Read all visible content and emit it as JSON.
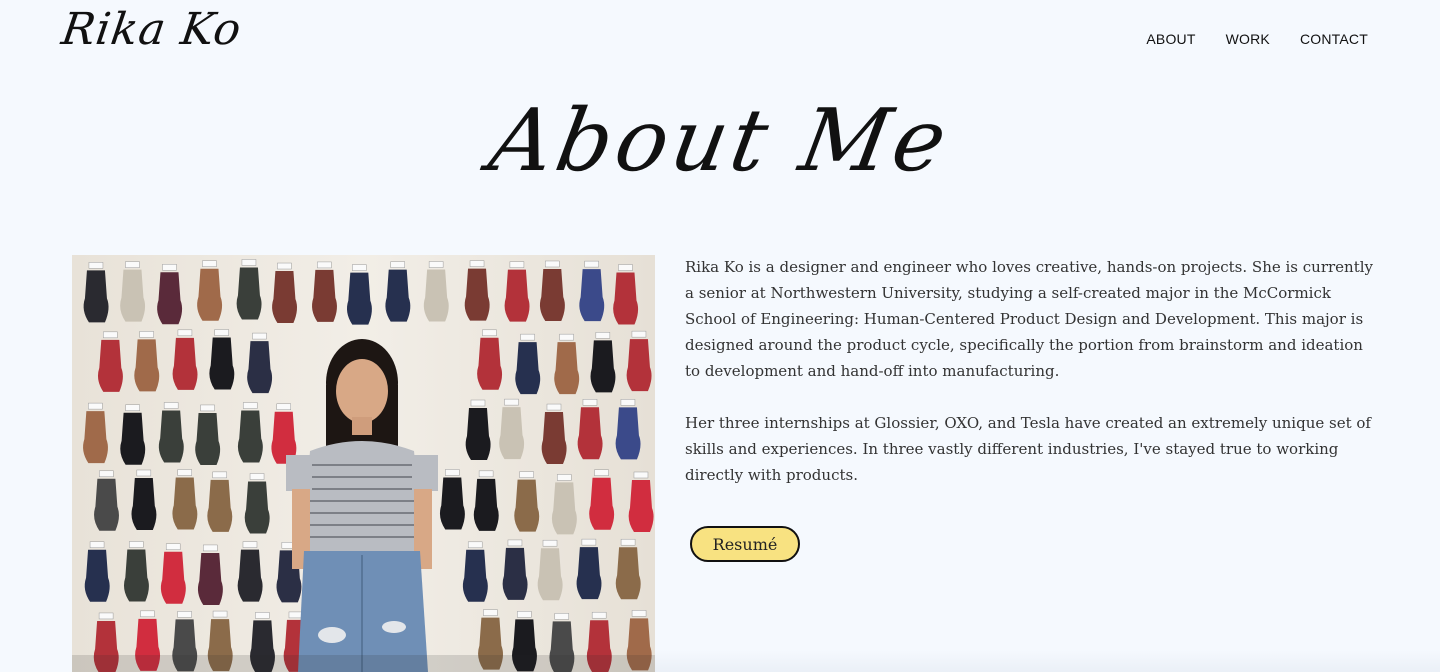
{
  "header": {
    "logo_text": "Rika Ko",
    "nav": [
      {
        "label": "ABOUT"
      },
      {
        "label": "WORK"
      },
      {
        "label": "CONTACT"
      }
    ]
  },
  "hero": {
    "title": "About Me"
  },
  "photo": {
    "alt": "Rika Ko standing in front of a wall of hanging gloves"
  },
  "bio": {
    "paragraphs": [
      "Rika Ko is a designer and engineer who loves creative, hands-on projects. She is currently a senior at Northwestern University, studying a self-created major in the McCormick School of Engineering: Human-Centered Product Design and Development. This major is designed around the product cycle, specifically the portion from brainstorm and ideation to development and hand-off into manufacturing.",
      "Her three internships at Glossier, OXO, and Tesla have created an extremely unique set of skills and experiences. In three vastly different industries, I've stayed true to working directly with products."
    ]
  },
  "cta": {
    "resume_label": "Resumé"
  },
  "colors": {
    "background": "#f5f9fe",
    "button_fill": "#f8e281",
    "text": "#333333"
  }
}
